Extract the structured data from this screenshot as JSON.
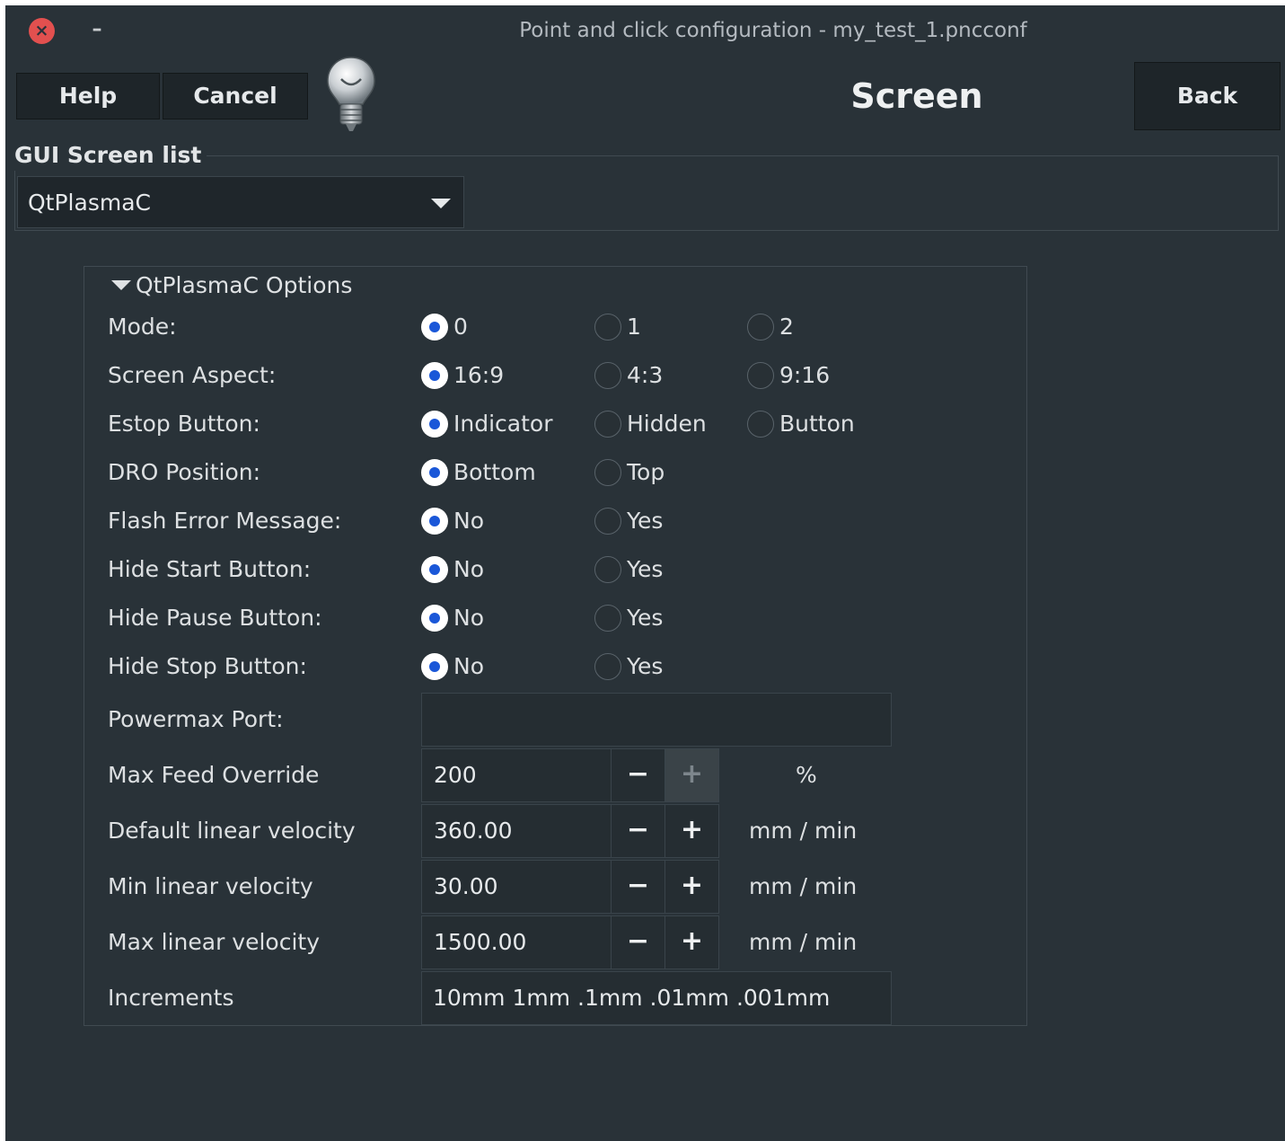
{
  "window": {
    "title": "Point and click configuration - my_test_1.pncconf",
    "close_glyph": "×",
    "minimize_glyph": "–"
  },
  "toolbar": {
    "help_label": "Help",
    "cancel_label": "Cancel",
    "back_label": "Back",
    "page_title": "Screen",
    "hint_icon": "lightbulb-icon"
  },
  "gui_screen_list": {
    "label": "GUI Screen list",
    "selected": "QtPlasmaC"
  },
  "options": {
    "header": "QtPlasmaC Options",
    "radio_rows": [
      {
        "label": "Mode:",
        "options": [
          "0",
          "1",
          "2"
        ],
        "selected": 0
      },
      {
        "label": "Screen Aspect:",
        "options": [
          "16:9",
          "4:3",
          "9:16"
        ],
        "selected": 0
      },
      {
        "label": "Estop Button:",
        "options": [
          "Indicator",
          "Hidden",
          "Button"
        ],
        "selected": 0
      },
      {
        "label": "DRO Position:",
        "options": [
          "Bottom",
          "Top"
        ],
        "selected": 0
      },
      {
        "label": "Flash Error Message:",
        "options": [
          "No",
          "Yes"
        ],
        "selected": 0
      },
      {
        "label": "Hide Start Button:",
        "options": [
          "No",
          "Yes"
        ],
        "selected": 0
      },
      {
        "label": "Hide Pause Button:",
        "options": [
          "No",
          "Yes"
        ],
        "selected": 0
      },
      {
        "label": "Hide Stop Button:",
        "options": [
          "No",
          "Yes"
        ],
        "selected": 0
      }
    ],
    "powermax_port": {
      "label": "Powermax Port:",
      "value": ""
    },
    "spin_rows": [
      {
        "label": "Max Feed Override",
        "value": "200",
        "unit": "%",
        "plus_disabled": true
      },
      {
        "label": "Default linear velocity",
        "value": "360.00",
        "unit": "mm / min",
        "plus_disabled": false
      },
      {
        "label": "Min linear velocity",
        "value": "30.00",
        "unit": "mm / min",
        "plus_disabled": false
      },
      {
        "label": "Max linear velocity",
        "value": "1500.00",
        "unit": "mm / min",
        "plus_disabled": false
      }
    ],
    "increments": {
      "label": "Increments",
      "value": "10mm 1mm .1mm .01mm .001mm"
    },
    "spin_minus_glyph": "−",
    "spin_plus_glyph": "+"
  },
  "colors": {
    "background": "#293238",
    "button": "#1e2529",
    "radio_selected": "#1a57d8",
    "close_button": "#e2504f"
  }
}
